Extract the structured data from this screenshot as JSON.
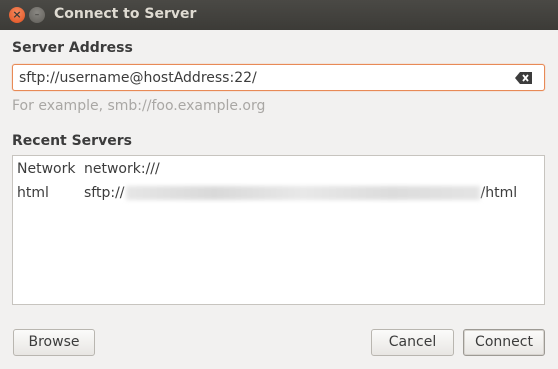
{
  "window": {
    "title": "Connect to Server",
    "close_glyph": "×",
    "minimize_glyph": "–"
  },
  "server_address": {
    "heading": "Server Address",
    "value": "sftp://username@hostAddress:22/",
    "hint": "For example, smb://foo.example.org",
    "clear_icon": "backspace-clear-icon"
  },
  "recent": {
    "heading": "Recent Servers",
    "rows": [
      {
        "name": "Network",
        "uri_prefix": "network:///",
        "uri_suffix": ""
      },
      {
        "name": "html",
        "uri_prefix": "sftp://",
        "uri_suffix": "/html"
      }
    ]
  },
  "buttons": {
    "browse": "Browse",
    "cancel": "Cancel",
    "connect": "Connect"
  },
  "colors": {
    "titlebar": "#3c3b37",
    "focus_border": "#e88a56",
    "close_button": "#e0501f",
    "background": "#f2f1f0"
  }
}
